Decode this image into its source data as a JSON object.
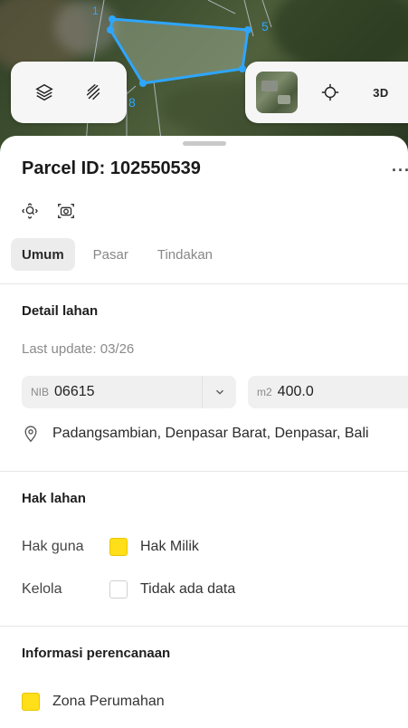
{
  "map": {
    "parcel_labels": [
      "1",
      "5",
      "8"
    ]
  },
  "map_controls": {
    "layers_icon": "layers-icon",
    "draw_icon": "draw-tool-icon",
    "satellite_icon": "satellite-thumbnail",
    "locate_icon": "crosshair-icon",
    "three_d_label": "3D"
  },
  "sheet": {
    "title": "Parcel ID: 102550539",
    "more_label": "···",
    "tools": [
      "zoom-to-parcel-icon",
      "screenshot-icon"
    ],
    "tabs": [
      {
        "label": "Umum",
        "active": true
      },
      {
        "label": "Pasar",
        "active": false
      },
      {
        "label": "Tindakan",
        "active": false
      }
    ]
  },
  "detail": {
    "title": "Detail lahan",
    "last_update": "Last update: 03/26",
    "nib_prefix": "NIB",
    "nib_value": "06615",
    "area_prefix": "m2",
    "area_value": "400.0",
    "address": "Padangsambian, Denpasar Barat, Denpasar, Bali"
  },
  "rights": {
    "title": "Hak lahan",
    "rows": [
      {
        "key": "Hak guna",
        "value": "Hak Milik",
        "swatch": "#ffde1a"
      },
      {
        "key": "Kelola",
        "value": "Tidak ada data",
        "swatch": "#ffffff"
      }
    ]
  },
  "planning": {
    "title": "Informasi perencanaan",
    "zone": "Zona Perumahan",
    "zone_color": "#ffde1a"
  }
}
